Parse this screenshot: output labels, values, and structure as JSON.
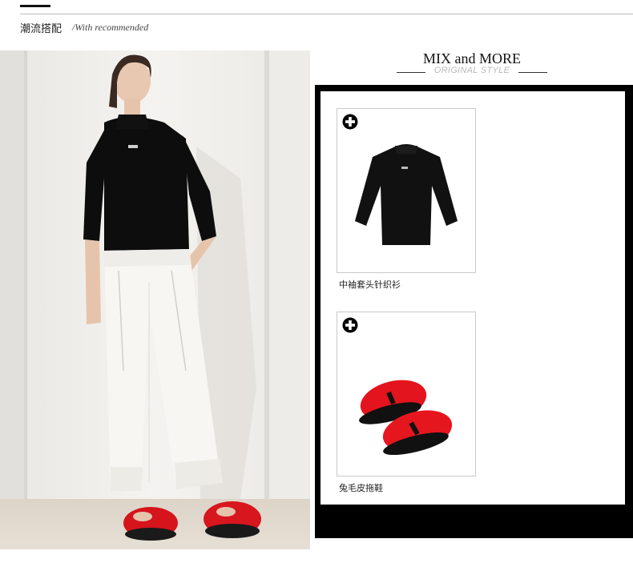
{
  "header": {
    "title": "潮流搭配",
    "subtitle": "/With recommended"
  },
  "panel": {
    "title": "MIX and MORE",
    "subtitle": "ORIGINAL STYLE"
  },
  "products": [
    {
      "name": "中袖套头针织衫",
      "icon": "plus-icon",
      "image": "black-knit-sweater"
    },
    {
      "name": "兔毛皮拖鞋",
      "icon": "plus-icon",
      "image": "red-fur-slides"
    }
  ],
  "look_photo": {
    "image": "model-black-top-white-pants-red-fur-slides"
  },
  "colors": {
    "frame": "#000000",
    "accent_red": "#e0141e",
    "rule": "#bcbcbc"
  }
}
